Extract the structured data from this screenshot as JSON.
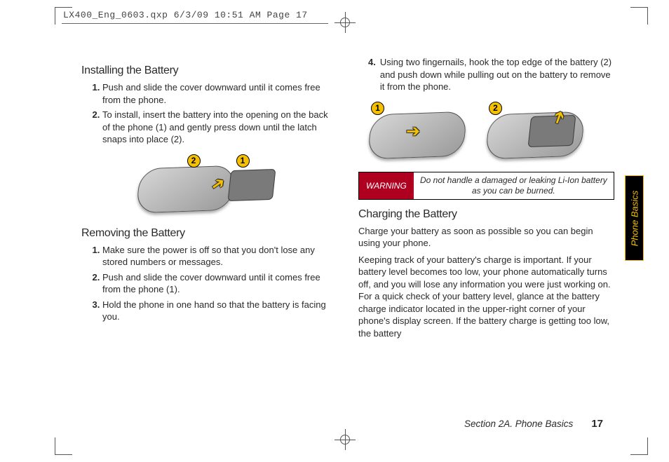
{
  "header_meta": "LX400_Eng_0603.qxp  6/3/09  10:51 AM  Page 17",
  "side_tab": "Phone Basics",
  "footer": {
    "section": "Section 2A. Phone Basics",
    "page": "17"
  },
  "icons": {
    "badge1": "1",
    "badge2": "2"
  },
  "left": {
    "h_installing": "Installing the Battery",
    "install_steps": [
      "Push and slide the cover downward until it comes free from the phone.",
      "To install, insert the battery into the opening on the back of the phone (1) and gently press down until the latch snaps into place (2)."
    ],
    "h_removing": "Removing the Battery",
    "remove_steps": [
      "Make sure the power is off so that you don't lose any stored numbers or messages.",
      "Push and slide the cover downward until it comes free from the phone (1).",
      "Hold the phone in one hand so that the battery is facing you."
    ]
  },
  "right": {
    "step4": "Using two fingernails, hook the top edge of the battery (2) and push down while pulling out on the battery to remove it from the phone.",
    "step4_marker": "4.",
    "warning_label": "WARNING",
    "warning_text": "Do not handle a damaged or leaking Li-Ion battery as you can be burned.",
    "h_charging": "Charging the Battery",
    "charging_p1": "Charge your battery as soon as possible so you can begin using your phone.",
    "charging_p2": "Keeping track of your battery's charge is important. If your battery level becomes too low, your phone automatically turns off, and you will lose any information you were just working on. For a quick check of your battery level, glance at the battery charge indicator located in the upper-right corner of your phone's display screen. If the battery charge is getting too low, the battery"
  }
}
